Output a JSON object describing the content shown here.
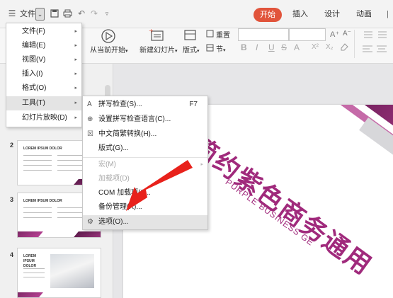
{
  "titlebar": {
    "file_label": "文件",
    "dropdown_glyph": "⌄",
    "tabs": [
      "开始",
      "插入",
      "设计",
      "动画"
    ],
    "active_tab_color": "#e1543b"
  },
  "ribbon": {
    "play_label": "从当前开始",
    "new_slide_label": "新建幻灯片",
    "layout_label": "版式",
    "section_label": "节",
    "reset_label": "重置",
    "dropdown_glyph": "▾",
    "format_glyphs": [
      "B",
      "I",
      "U",
      "S",
      "A",
      "X²",
      "X₂"
    ],
    "size_glyphs": [
      "A⁺",
      "A⁻"
    ]
  },
  "file_menu": {
    "items": [
      {
        "label": "文件(F)"
      },
      {
        "label": "编辑(E)"
      },
      {
        "label": "视图(V)"
      },
      {
        "label": "插入(I)"
      },
      {
        "label": "格式(O)"
      },
      {
        "label": "工具(T)"
      },
      {
        "label": "幻灯片放映(D)"
      }
    ],
    "submenu_glyph": "▸"
  },
  "tools_menu": {
    "items": [
      {
        "label": "拼写检查(S)...",
        "shortcut": "F7",
        "icon": "spell-check-icon"
      },
      {
        "label": "设置拼写检查语言(C)...",
        "icon": "language-icon"
      },
      {
        "label": "中文简繁转换(H)...",
        "icon": "chinese-convert-icon"
      },
      {
        "label": "版式(G)..."
      },
      {
        "label": "宏(M)"
      },
      {
        "label": "加载项(D)"
      },
      {
        "label": "COM 加载项(I)..."
      },
      {
        "label": "备份管理(K)..."
      },
      {
        "label": "选项(O)...",
        "icon": "gear-icon"
      }
    ]
  },
  "thumbnails": [
    {
      "num": "2",
      "title": "LOREM IPSUM DOLOR"
    },
    {
      "num": "3",
      "title": "LOREM IPSUM DOLOR"
    },
    {
      "num": "4",
      "title": "LOREM IPSUM DOLOR"
    }
  ],
  "slide": {
    "title": "简约紫色商务通用",
    "subtitle": "PURPLE BUSINESS GE",
    "accent": "#a02a7c"
  }
}
